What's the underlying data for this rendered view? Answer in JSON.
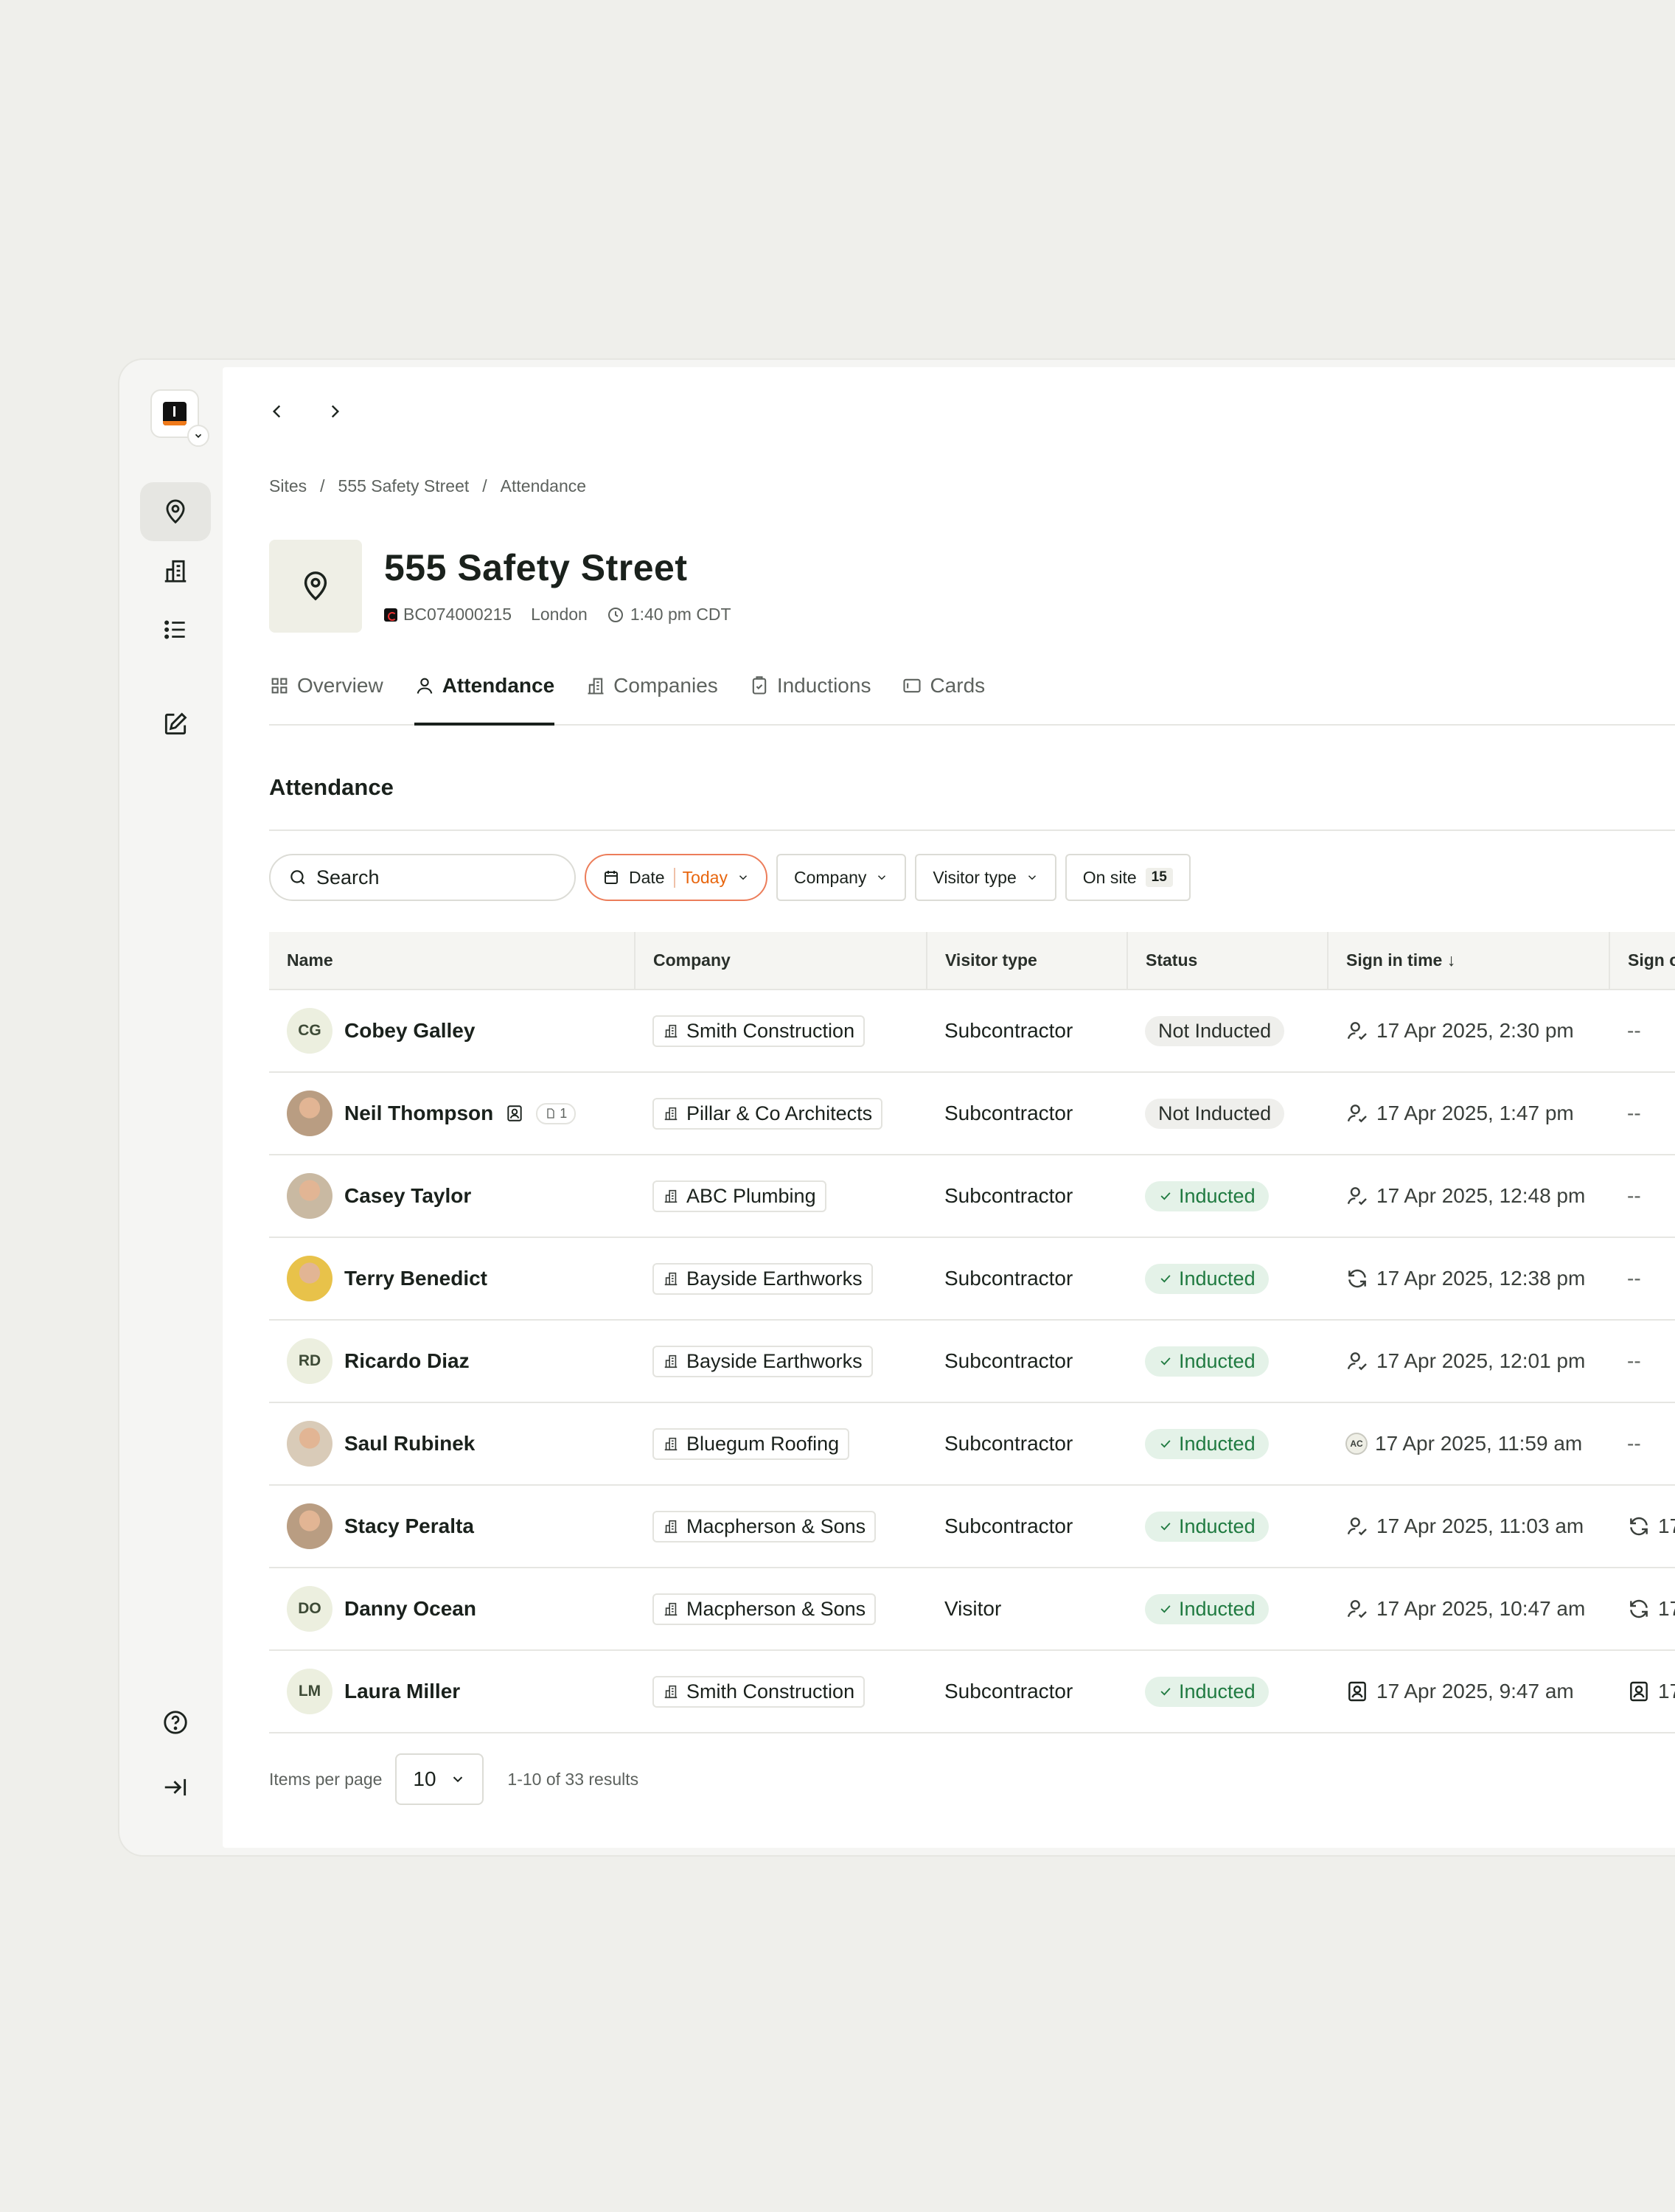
{
  "nav": {
    "back_label": "‹",
    "forward_label": "›"
  },
  "breadcrumb": {
    "items": [
      "Sites",
      "555 Safety Street",
      "Attendance"
    ],
    "separator": "/"
  },
  "site": {
    "title": "555 Safety Street",
    "code": "BC074000215",
    "city": "London",
    "time": "1:40 pm CDT"
  },
  "tabs": [
    "Overview",
    "Attendance",
    "Companies",
    "Inductions",
    "Cards"
  ],
  "section": {
    "title": "Attendance"
  },
  "filters": {
    "search_placeholder": "Search",
    "date_label": "Date",
    "date_value": "Today",
    "company_label": "Company",
    "visitor_type_label": "Visitor type",
    "on_site_label": "On site",
    "on_site_count": "15"
  },
  "table": {
    "columns": [
      "Name",
      "Company",
      "Visitor type",
      "Status",
      "Sign in time ↓",
      "Sign o"
    ],
    "rows": [
      {
        "initials": "CG",
        "name": "Cobey Galley",
        "company": "Smith Construction",
        "visitor_type": "Subcontractor",
        "status": "Not Inducted",
        "sign_in": "17 Apr 2025, 2:30 pm",
        "sign_in_icon": "user-check-icon",
        "sign_out": "--"
      },
      {
        "initials": "",
        "name": "Neil Thompson",
        "badge_count": "1",
        "company": "Pillar & Co Architects",
        "visitor_type": "Subcontractor",
        "status": "Not Inducted",
        "sign_in": "17 Apr 2025, 1:47 pm",
        "sign_in_icon": "user-check-icon",
        "sign_out": "--"
      },
      {
        "initials": "",
        "name": "Casey Taylor",
        "company": "ABC Plumbing",
        "visitor_type": "Subcontractor",
        "status": "Inducted",
        "sign_in": "17 Apr 2025, 12:48 pm",
        "sign_in_icon": "user-check-icon",
        "sign_out": "--"
      },
      {
        "initials": "",
        "name": "Terry Benedict",
        "company": "Bayside Earthworks",
        "visitor_type": "Subcontractor",
        "status": "Inducted",
        "sign_in": "17 Apr 2025, 12:38 pm",
        "sign_in_icon": "refresh-icon",
        "sign_out": "--"
      },
      {
        "initials": "RD",
        "name": "Ricardo Diaz",
        "company": "Bayside Earthworks",
        "visitor_type": "Subcontractor",
        "status": "Inducted",
        "sign_in": "17 Apr 2025, 12:01 pm",
        "sign_in_icon": "user-check-icon",
        "sign_out": "--"
      },
      {
        "initials": "",
        "name": "Saul Rubinek",
        "company": "Bluegum Roofing",
        "visitor_type": "Subcontractor",
        "status": "Inducted",
        "sign_in": "17 Apr 2025, 11:59 am",
        "sign_in_icon": "ac-badge-icon",
        "sign_in_badge": "AC",
        "sign_out": "--"
      },
      {
        "initials": "",
        "name": "Stacy Peralta",
        "company": "Macpherson & Sons",
        "visitor_type": "Subcontractor",
        "status": "Inducted",
        "sign_in": "17 Apr 2025, 11:03 am",
        "sign_in_icon": "user-check-icon",
        "sign_out": "17",
        "sign_out_icon": "refresh-icon"
      },
      {
        "initials": "DO",
        "name": "Danny Ocean",
        "company": "Macpherson & Sons",
        "visitor_type": "Visitor",
        "status": "Inducted",
        "sign_in": "17 Apr 2025, 10:47 am",
        "sign_in_icon": "user-check-icon",
        "sign_out": "17",
        "sign_out_icon": "refresh-icon"
      },
      {
        "initials": "LM",
        "name": "Laura Miller",
        "company": "Smith Construction",
        "visitor_type": "Subcontractor",
        "status": "Inducted",
        "sign_in": "17 Apr 2025, 9:47 am",
        "sign_in_icon": "id-card-icon",
        "sign_out": "17",
        "sign_out_icon": "id-card-icon"
      }
    ]
  },
  "pagination": {
    "items_per_page_label": "Items per page",
    "page_size": "10",
    "results": "1-10 of 33 results"
  },
  "colors": {
    "accent_orange": "#e8660e",
    "inducted_green": "#1f7a40",
    "inducted_bg": "#e4f2e8",
    "page_bg": "#efefeb"
  }
}
